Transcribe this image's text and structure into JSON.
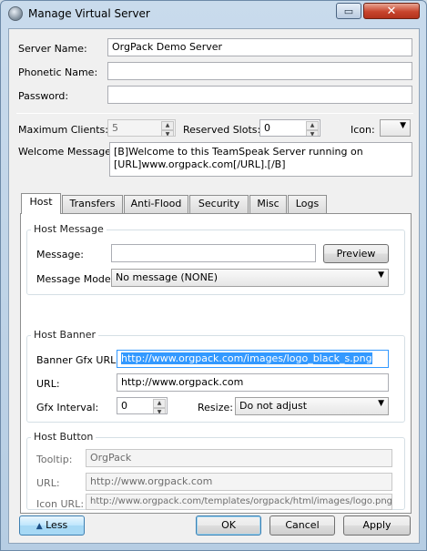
{
  "window": {
    "title": "Manage Virtual Server"
  },
  "fields": {
    "server_name_label": "Server Name:",
    "server_name_value": "OrgPack Demo Server",
    "phonetic_name_label": "Phonetic Name:",
    "phonetic_name_value": "",
    "password_label": "Password:",
    "password_value": "",
    "max_clients_label": "Maximum Clients:",
    "max_clients_value": "5",
    "reserved_slots_label": "Reserved Slots:",
    "reserved_slots_value": "0",
    "icon_label": "Icon:",
    "welcome_label": "Welcome Message:",
    "welcome_line1": "[B]Welcome to this TeamSpeak Server running on",
    "welcome_line2": "[URL]www.orgpack.com[/URL].[/B]"
  },
  "tabs": [
    {
      "label": "Host",
      "active": true
    },
    {
      "label": "Transfers",
      "active": false
    },
    {
      "label": "Anti-Flood",
      "active": false
    },
    {
      "label": "Security",
      "active": false
    },
    {
      "label": "Misc",
      "active": false
    },
    {
      "label": "Logs",
      "active": false
    }
  ],
  "host_message": {
    "title": "Host Message",
    "message_label": "Message:",
    "message_value": "",
    "preview_label": "Preview",
    "mode_label": "Message Mode:",
    "mode_value": "No message (NONE)"
  },
  "host_banner": {
    "title": "Host Banner",
    "gfx_url_label": "Banner Gfx URL:",
    "gfx_url_value": "http://www.orgpack.com/images/logo_black_s.png",
    "url_label": "URL:",
    "url_value": "http://www.orgpack.com",
    "interval_label": "Gfx Interval:",
    "interval_value": "0",
    "resize_label": "Resize:",
    "resize_value": "Do not adjust"
  },
  "host_button": {
    "title": "Host Button",
    "tooltip_label": "Tooltip:",
    "tooltip_value": "OrgPack",
    "url_label": "URL:",
    "url_value": "http://www.orgpack.com",
    "icon_url_label": "Icon URL:",
    "icon_url_value": "http://www.orgpack.com/templates/orgpack/html/images/logo.png"
  },
  "footer": {
    "less_label": "Less",
    "ok_label": "OK",
    "cancel_label": "Cancel",
    "apply_label": "Apply"
  },
  "colors": {
    "selection": "#3399ff",
    "close_button": "#c8452d"
  }
}
